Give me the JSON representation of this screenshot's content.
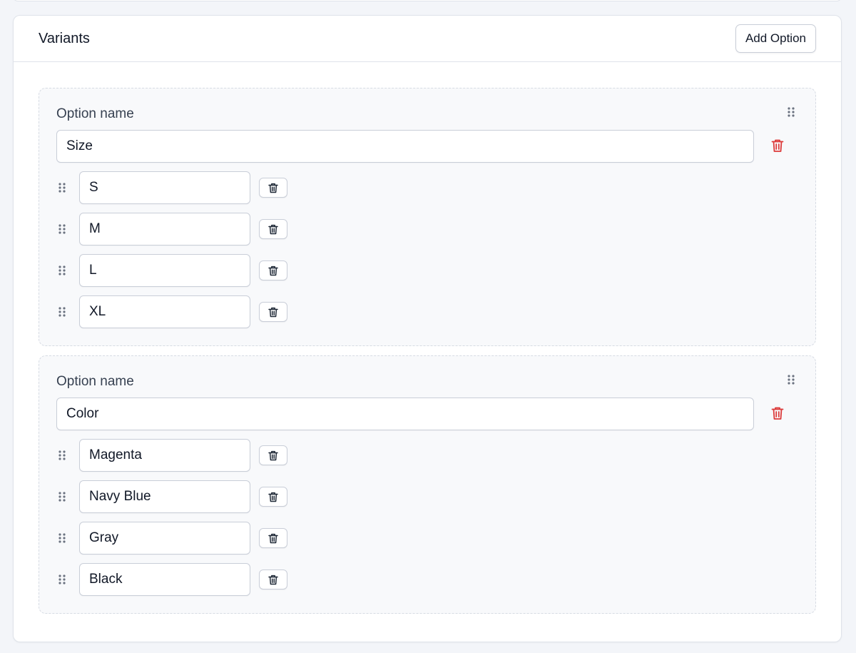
{
  "card": {
    "title": "Variants",
    "add_option_label": "Add Option"
  },
  "icons": {
    "drag_handle": "drag-handle-icon",
    "trash": "trash-icon"
  },
  "colors": {
    "delete_accent": "#dc3b3b",
    "icon_gray": "#6b7280"
  },
  "option_groups": [
    {
      "label": "Option name",
      "name_value": "Size",
      "values": [
        "S",
        "M",
        "L",
        "XL"
      ]
    },
    {
      "label": "Option name",
      "name_value": "Color",
      "values": [
        "Magenta",
        "Navy Blue",
        "Gray",
        "Black"
      ]
    }
  ]
}
